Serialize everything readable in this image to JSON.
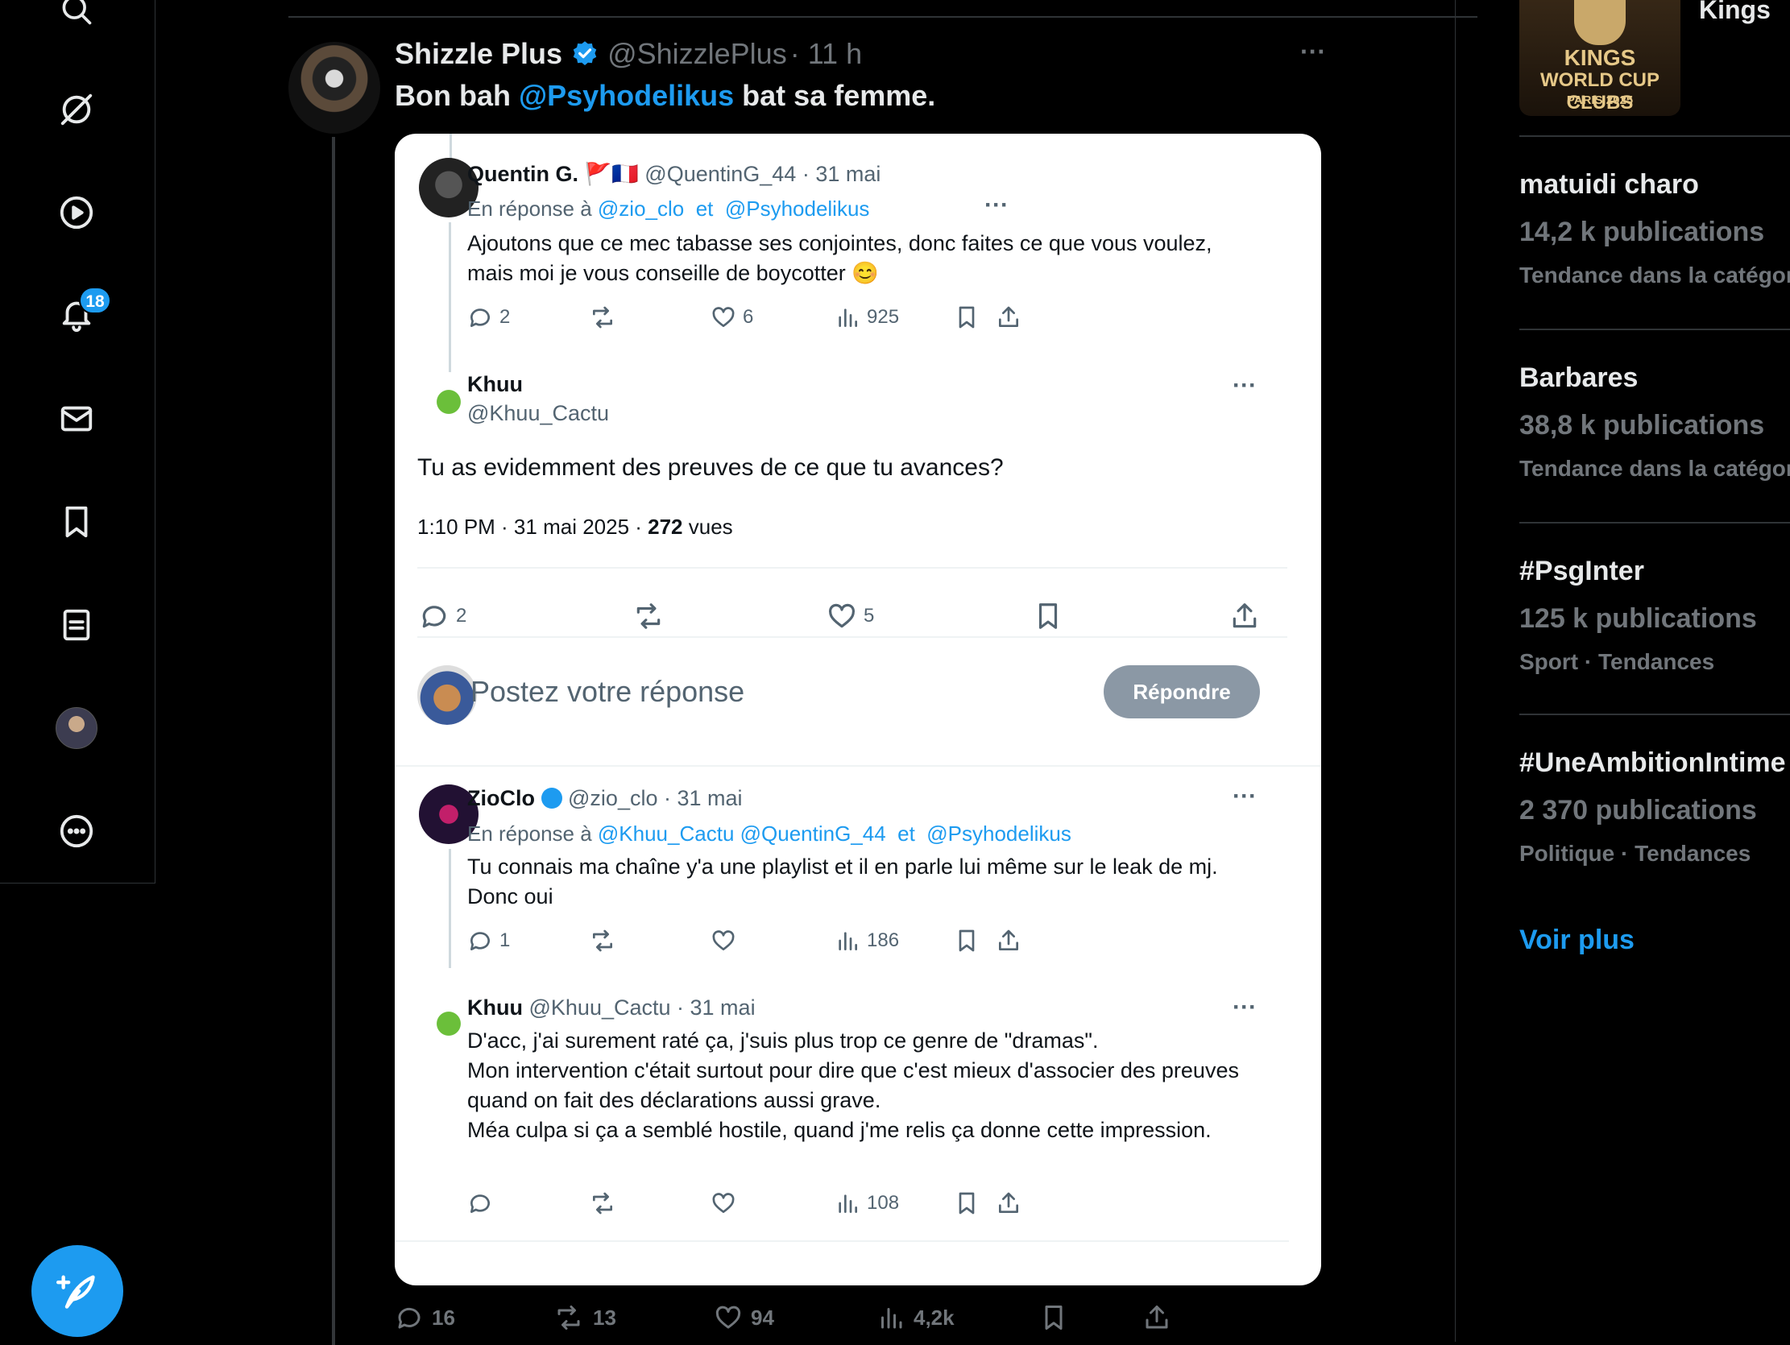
{
  "nav": {
    "notification_count": "18",
    "items": [
      "search-icon",
      "grok-icon",
      "video-icon",
      "notifications-icon",
      "messages-icon",
      "bookmarks-icon",
      "lists-icon",
      "profile-icon",
      "more-icon"
    ]
  },
  "tweet": {
    "display_name": "Shizzle Plus",
    "handle": "@ShizzlePlus",
    "time": "· 11 h",
    "more": "···",
    "body_prefix": "Bon bah ",
    "body_mention": "@Psyhodelikus",
    "body_suffix": " bat sa femme.",
    "stats": {
      "replies": "16",
      "retweets": "13",
      "likes": "94",
      "views": "4,2k"
    }
  },
  "card": {
    "reply1": {
      "name": "Quentin G.",
      "flags": "🚩🇫🇷",
      "handle": "@QuentinG_44",
      "date": "· 31 mai",
      "reply_to_label": "En réponse à",
      "reply_to_1": "@zio_clo",
      "conj": "et",
      "reply_to_2": "@Psyhodelikus",
      "text": "Ajoutons que ce mec tabasse ses conjointes, donc faites ce que vous voulez, mais moi je vous conseille de boycotter 😊",
      "replies": "2",
      "likes": "6",
      "views": "925"
    },
    "main": {
      "name": "Khuu",
      "handle": "@Khuu_Cactu",
      "text": "Tu as evidemment des preuves de ce que tu avances?",
      "timestamp": "1:10 PM · 31 mai 2025 · ",
      "views_count": "272",
      "views_label": " vues",
      "replies": "2",
      "likes": "5"
    },
    "composer": {
      "placeholder": "Postez votre réponse",
      "button": "Répondre"
    },
    "reply2": {
      "name": "ZioClo",
      "handle": "@zio_clo",
      "date": "· 31 mai",
      "reply_to_label": "En réponse à",
      "reply_to_1": "@Khuu_Cactu @QuentinG_44",
      "conj": "et",
      "reply_to_2": "@Psyhodelikus",
      "text": "Tu connais ma chaîne y'a une playlist et il en parle lui même sur le leak de mj.  Donc oui",
      "replies": "1",
      "views": "186"
    },
    "reply3": {
      "name": "Khuu",
      "handle": "@Khuu_Cactu",
      "date": "· 31 mai",
      "line1": "D'acc, j'ai surement raté ça, j'suis plus trop ce genre de  \"dramas\".",
      "line2": "Mon intervention c'était surtout pour dire que c'est mieux d'associer des preuves quand on fait des déclarations aussi grave.",
      "line3": "Méa culpa si ça a semblé hostile, quand j'me relis ça donne cette impression.",
      "views": "108"
    }
  },
  "sidebar": {
    "kings_title": "Kings",
    "kings_logo_text": "KINGS",
    "kings_logo_sub": "WORLD CUP CLUBS",
    "kings_logo_city": "PARIS 2025",
    "trends": [
      {
        "name": "matuidi charo",
        "count": "14,2 k publications",
        "meta": "Tendance dans la catégorie"
      },
      {
        "name": "Barbares",
        "count": "38,8 k publications",
        "meta": "Tendance dans la catégorie"
      },
      {
        "name": "#PsgInter",
        "count": "125 k publications",
        "meta": "Sport · Tendances"
      },
      {
        "name": "#UneAmbitionIntime",
        "count": "2 370 publications",
        "meta": "Politique · Tendances"
      }
    ],
    "see_more": "Voir plus"
  },
  "colors": {
    "accent": "#1d9bf0",
    "background": "#000000",
    "card": "#ffffff",
    "muted": "#71767b"
  }
}
